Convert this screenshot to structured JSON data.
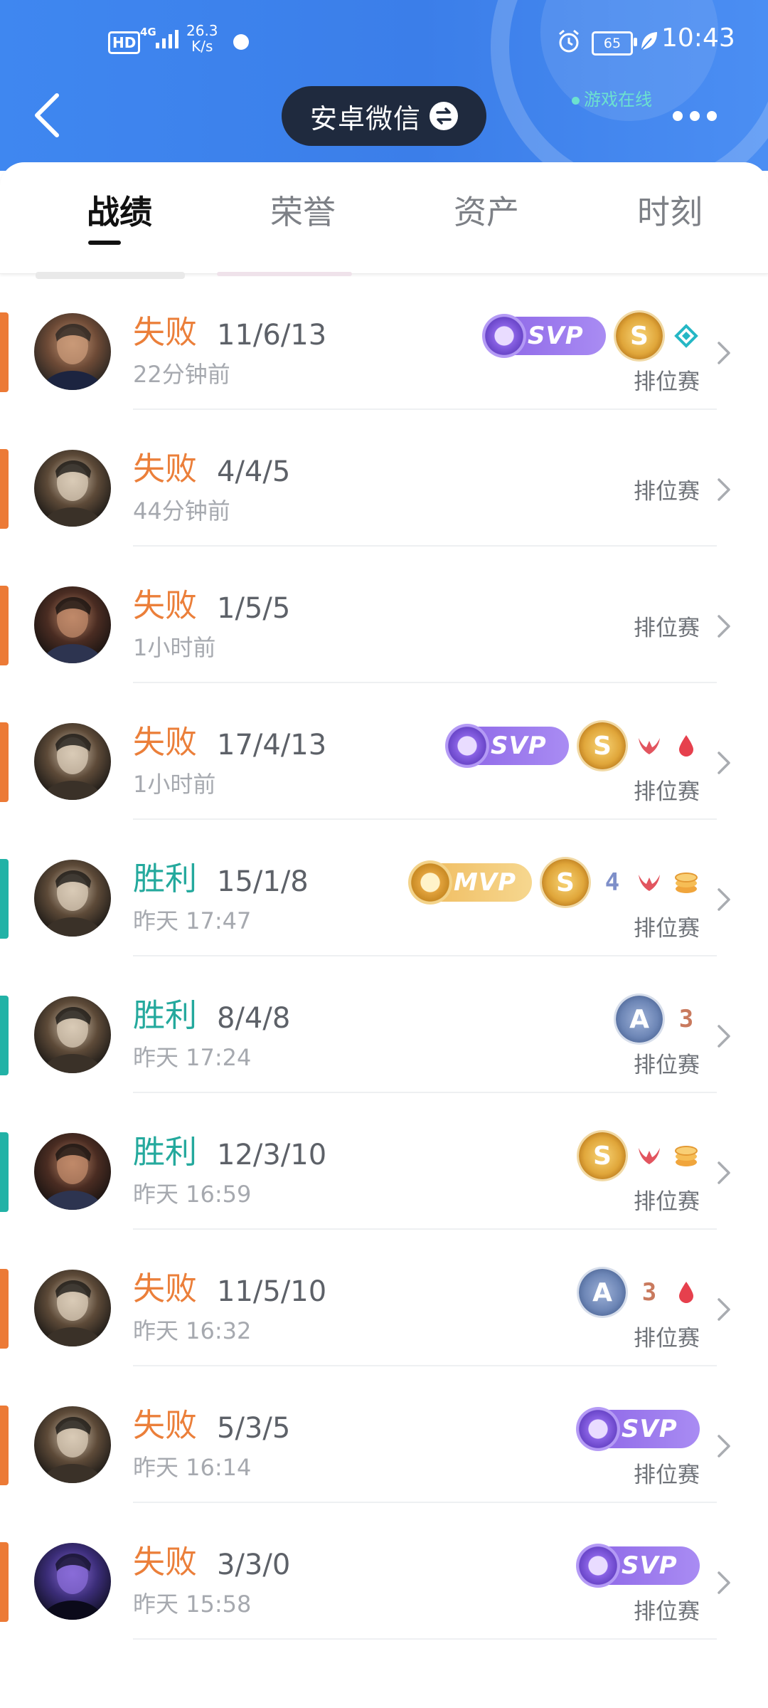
{
  "status_bar": {
    "hd": "HD",
    "network": "4G",
    "speed_value": "26.3",
    "speed_unit": "K/s",
    "battery": "65",
    "time": "10:43"
  },
  "header": {
    "account_name": "安卓微信",
    "online_status": "游戏在线"
  },
  "tabs": [
    {
      "label": "战绩",
      "active": true
    },
    {
      "label": "荣誉",
      "active": false
    },
    {
      "label": "资产",
      "active": false
    },
    {
      "label": "时刻",
      "active": false
    }
  ],
  "matches": [
    {
      "result": "失败",
      "kda": "11/6/13",
      "time": "22分钟前",
      "mode": "排位赛",
      "badges": [
        "svp-badge",
        "gold-s-medal",
        "diamond-icon"
      ],
      "hero": "hero-a"
    },
    {
      "result": "失败",
      "kda": "4/4/5",
      "time": "44分钟前",
      "mode": "排位赛",
      "badges": [],
      "hero": "hero-b"
    },
    {
      "result": "失败",
      "kda": "1/5/5",
      "time": "1小时前",
      "mode": "排位赛",
      "badges": [],
      "hero": "hero-c"
    },
    {
      "result": "失败",
      "kda": "17/4/13",
      "time": "1小时前",
      "mode": "排位赛",
      "badges": [
        "svp-badge",
        "gold-s-medal",
        "claw-icon",
        "blood-drop-icon"
      ],
      "hero": "hero-b"
    },
    {
      "result": "胜利",
      "kda": "15/1/8",
      "time": "昨天 17:47",
      "mode": "排位赛",
      "badges": [
        "mvp-badge",
        "gold-s-medal",
        "quadra-kill-icon",
        "claw-icon",
        "coins-icon"
      ],
      "hero": "hero-b"
    },
    {
      "result": "胜利",
      "kda": "8/4/8",
      "time": "昨天 17:24",
      "mode": "排位赛",
      "badges": [
        "silver-a-medal",
        "triple-kill-icon"
      ],
      "hero": "hero-b"
    },
    {
      "result": "胜利",
      "kda": "12/3/10",
      "time": "昨天 16:59",
      "mode": "排位赛",
      "badges": [
        "gold-s-medal",
        "claw-icon",
        "coins-icon"
      ],
      "hero": "hero-c"
    },
    {
      "result": "失败",
      "kda": "11/5/10",
      "time": "昨天 16:32",
      "mode": "排位赛",
      "badges": [
        "silver-a-medal",
        "triple-kill-icon",
        "blood-drop-icon"
      ],
      "hero": "hero-b"
    },
    {
      "result": "失败",
      "kda": "5/3/5",
      "time": "昨天 16:14",
      "mode": "排位赛",
      "badges": [
        "svp-badge"
      ],
      "hero": "hero-b"
    },
    {
      "result": "失败",
      "kda": "3/3/0",
      "time": "昨天 15:58",
      "mode": "排位赛",
      "badges": [
        "svp-badge"
      ],
      "hero": "hero-d"
    }
  ],
  "badge_text": {
    "svp": "SVP",
    "mvp": "MVP",
    "medal_s": "S",
    "medal_a": "A",
    "quadra": "4",
    "triple": "3"
  },
  "colors": {
    "header_blue": "#3f87f0",
    "loss": "#eb7f3a",
    "win": "#24a99d",
    "svp_purple": "#8b63e6",
    "mvp_gold": "#efb95a"
  }
}
